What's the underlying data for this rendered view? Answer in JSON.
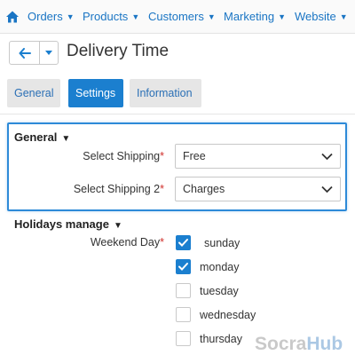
{
  "nav": {
    "items": [
      {
        "label": "Orders"
      },
      {
        "label": "Products"
      },
      {
        "label": "Customers"
      },
      {
        "label": "Marketing"
      },
      {
        "label": "Website"
      }
    ]
  },
  "header": {
    "title": "Delivery Time"
  },
  "tabs": [
    {
      "label": "General",
      "active": false
    },
    {
      "label": "Settings",
      "active": true
    },
    {
      "label": "Information",
      "active": false
    }
  ],
  "general": {
    "title": "General",
    "fields": [
      {
        "label": "Select Shipping",
        "required": "*",
        "value": "Free"
      },
      {
        "label": "Select Shipping 2",
        "required": "*",
        "value": "Charges"
      }
    ]
  },
  "holidays": {
    "title": "Holidays manage",
    "weekend_label": "Weekend Day",
    "required": "*",
    "days": [
      {
        "label": "sunday",
        "checked": true
      },
      {
        "label": "monday",
        "checked": true
      },
      {
        "label": "tuesday",
        "checked": false
      },
      {
        "label": "wednesday",
        "checked": false
      },
      {
        "label": "thursday",
        "checked": false
      }
    ]
  },
  "watermark": {
    "part1": "Socra",
    "part2": "Hub"
  },
  "colors": {
    "accent": "#1b7fcf",
    "link": "#1a75c4",
    "required": "#d0312d"
  }
}
